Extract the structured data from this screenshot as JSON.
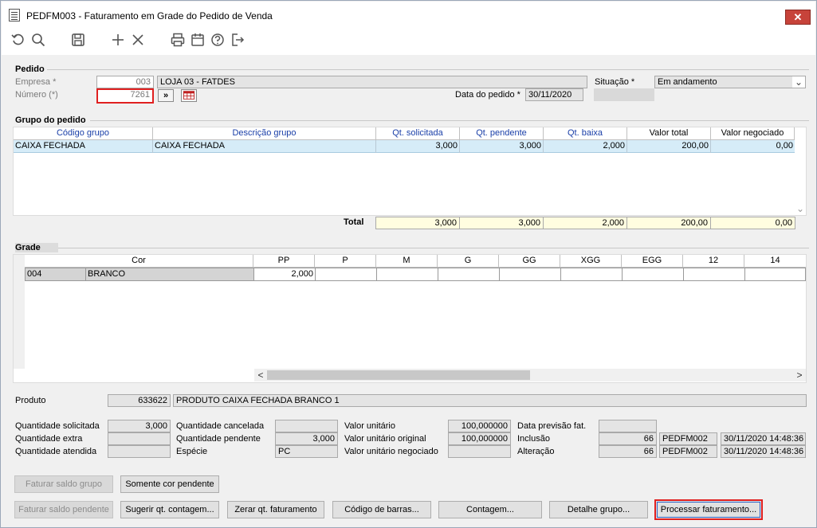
{
  "window": {
    "title": "PEDFM003 - Faturamento em Grade do Pedido de Venda",
    "close_label": "✕"
  },
  "toolbar": [
    "undo-icon",
    "search-icon",
    "save-icon",
    "add-icon",
    "delete-icon",
    "print-icon",
    "calendar-icon",
    "help-icon",
    "exit-icon"
  ],
  "pedido": {
    "section": "Pedido",
    "empresa_label": "Empresa *",
    "empresa_code": "003",
    "empresa_name": "LOJA 03 - FATDES",
    "numero_label": "Número (*)",
    "numero_value": "7261",
    "go_label": "»",
    "data_label": "Data do pedido *",
    "data_value": "30/11/2020",
    "situacao_label": "Situação *",
    "situacao_value": "Em andamento"
  },
  "grupo": {
    "section": "Grupo do pedido",
    "headers": [
      "Código grupo",
      "Descrição grupo",
      "Qt. solicitada",
      "Qt. pendente",
      "Qt. baixa",
      "Valor total",
      "Valor  negociado"
    ],
    "row": [
      "CAIXA FECHADA",
      "CAIXA FECHADA",
      "3,000",
      "3,000",
      "2,000",
      "200,00",
      "0,00"
    ],
    "total_label": "Total",
    "totals": [
      "3,000",
      "3,000",
      "2,000",
      "200,00",
      "0,00"
    ]
  },
  "grade": {
    "section": "Grade",
    "headers": [
      "Cor",
      "PP",
      "P",
      "M",
      "G",
      "GG",
      "XGG",
      "EGG",
      "12",
      "14"
    ],
    "row": {
      "code": "004",
      "name": "BRANCO",
      "pp": "2,000"
    }
  },
  "produto": {
    "label": "Produto",
    "code": "633622",
    "name": "PRODUTO CAIXA FECHADA BRANCO 1"
  },
  "details": {
    "qt_solicitada_label": "Quantidade solicitada",
    "qt_solicitada": "3,000",
    "qt_extra_label": "Quantidade extra",
    "qt_atendida_label": "Quantidade atendida",
    "qt_cancelada_label": "Quantidade cancelada",
    "qt_pendente_label": "Quantidade pendente",
    "qt_pendente": "3,000",
    "especie_label": "Espécie",
    "especie": "PC",
    "valor_unit_label": "Valor unitário",
    "valor_unit": "100,000000",
    "valor_unit_orig_label": "Valor unitário original",
    "valor_unit_orig": "100,000000",
    "valor_unit_neg_label": "Valor unitário negociado",
    "data_prev_label": "Data previsão fat.",
    "inclusao_label": "Inclusão",
    "inclusao_num": "66",
    "inclusao_prog": "PEDFM002",
    "inclusao_dt": "30/11/2020 14:48:36",
    "alteracao_label": "Alteração",
    "alteracao_num": "66",
    "alteracao_prog": "PEDFM002",
    "alteracao_dt": "30/11/2020 14:48:36"
  },
  "buttons": {
    "faturar_grupo": "Faturar saldo grupo",
    "somente_cor": "Somente cor pendente",
    "faturar_pendente": "Faturar saldo pendente",
    "sugerir": "Sugerir qt. contagem...",
    "zerar": "Zerar qt. faturamento",
    "codigo_barras": "Código de barras...",
    "contagem": "Contagem...",
    "detalhe": "Detalhe grupo...",
    "processar": "Processar faturamento..."
  },
  "scroll": {
    "left": "<",
    "right": ">",
    "down": "⌄"
  }
}
